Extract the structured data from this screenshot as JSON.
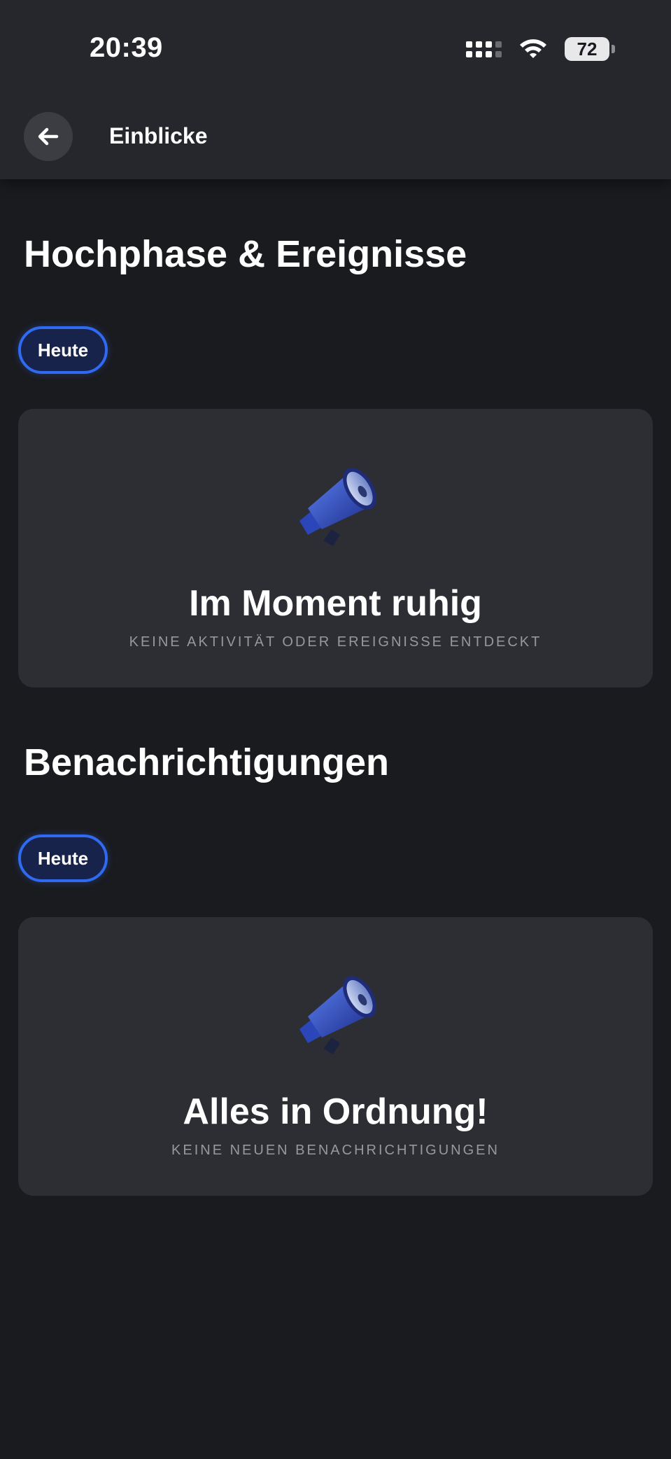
{
  "status_bar": {
    "time": "20:39",
    "battery": "72"
  },
  "header": {
    "title": "Einblicke",
    "back_icon": "arrow-left-icon"
  },
  "sections": [
    {
      "title": "Hochphase & Ereignisse",
      "chip": "Heute",
      "card": {
        "icon": "megaphone-icon",
        "title": "Im Moment ruhig",
        "subtitle": "KEINE AKTIVITÄT ODER EREIGNISSE ENTDECKT"
      }
    },
    {
      "title": "Benachrichtigungen",
      "chip": "Heute",
      "card": {
        "icon": "megaphone-icon",
        "title": "Alles in Ordnung!",
        "subtitle": "KEINE NEUEN BENACHRICHTIGUNGEN"
      }
    }
  ],
  "colors": {
    "accent": "#2f6af0",
    "background": "#1a1b1f",
    "card": "#2d2e33"
  }
}
